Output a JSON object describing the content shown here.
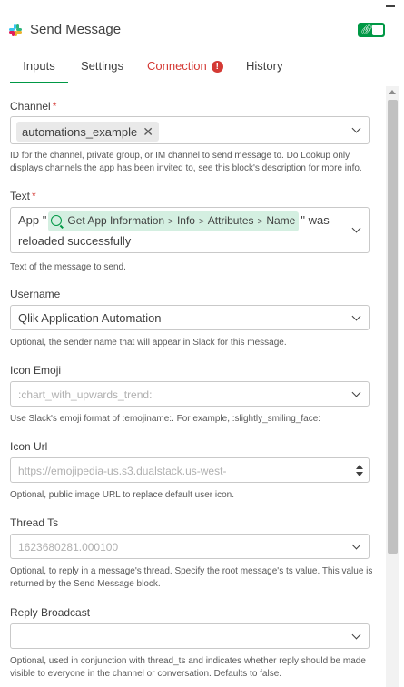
{
  "header": {
    "title": "Send Message",
    "slack_colors": [
      "#36C5F0",
      "#2EB67D",
      "#ECB22E",
      "#E01E5A"
    ],
    "toggle_icon": "link-icon"
  },
  "tabs": [
    {
      "label": "Inputs",
      "active": true
    },
    {
      "label": "Settings",
      "active": false
    },
    {
      "label": "Connection",
      "active": false,
      "error": true,
      "error_mark": "!"
    },
    {
      "label": "History",
      "active": false
    }
  ],
  "fields": {
    "channel": {
      "label": "Channel",
      "required_mark": "*",
      "chip": "automations_example",
      "chip_remove": "✕",
      "help": "ID for the channel, private group, or IM channel to send message to. Do Lookup only displays channels the app has been invited to, see this block's description for more info."
    },
    "text": {
      "label": "Text",
      "required_mark": "*",
      "prefix": "App \"",
      "pill_parts": [
        "Get App Information",
        "Info",
        "Attributes",
        "Name"
      ],
      "separator": ">",
      "suffix": "\" was",
      "line2": "reloaded successfully",
      "help": "Text of the message to send."
    },
    "username": {
      "label": "Username",
      "value": "Qlik Application Automation",
      "help": "Optional, the sender name that will appear in Slack for this message."
    },
    "icon_emoji": {
      "label": "Icon Emoji",
      "placeholder": ":chart_with_upwards_trend:",
      "help": "Use Slack's emoji format of :emojiname:. For example, :slightly_smiling_face:"
    },
    "icon_url": {
      "label": "Icon Url",
      "placeholder": "https://emojipedia-us.s3.dualstack.us-west-",
      "help": "Optional, public image URL to replace default user icon."
    },
    "thread_ts": {
      "label": "Thread Ts",
      "placeholder": "1623680281.000100",
      "help": "Optional, to reply in a message's thread. Specify the root message's ts value. This value is returned by the Send Message block."
    },
    "reply_broadcast": {
      "label": "Reply Broadcast",
      "value": "",
      "help": "Optional, used in conjunction with thread_ts and indicates whether reply should be made visible to everyone in the channel or conversation. Defaults to false."
    }
  },
  "colors": {
    "accent": "#009845",
    "error": "#d43a35",
    "pill_bg": "#d4efe1"
  }
}
